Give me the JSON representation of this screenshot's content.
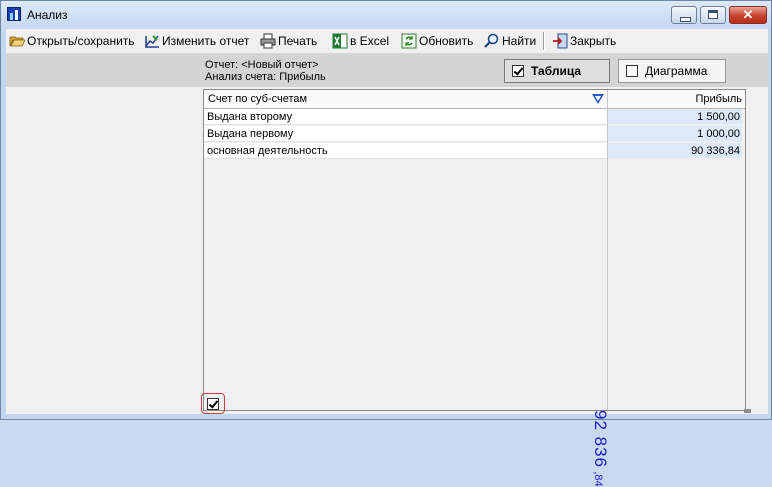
{
  "window": {
    "title": "Анализ"
  },
  "toolbar": {
    "open_save": "Открыть/сохранить",
    "edit_report": "Изменить отчет",
    "print": "Печать",
    "to_excel": "в Excel",
    "refresh": "Обновить",
    "find": "Найти",
    "close": "Закрыть"
  },
  "info": {
    "report_line": "Отчет:  <Новый отчет>",
    "analysis_line": "Анализ счета:  Прибыль"
  },
  "view": {
    "table_label": "Таблица",
    "table_checked": true,
    "chart_label": "Диаграмма",
    "chart_checked": false
  },
  "grid": {
    "columns": [
      "Счет по суб-счетам",
      "Прибыль"
    ],
    "rows": [
      {
        "name": "Выдана второму",
        "value": "1 500,00"
      },
      {
        "name": "Выдана первому",
        "value": "1 000,00"
      },
      {
        "name": "основная деятельность",
        "value": "90 336,84"
      }
    ],
    "total_int": "92 836",
    "total_frac": ",84"
  },
  "bottom_checkbox": {
    "checked": true
  },
  "colors": {
    "accent": "#1c1ccf",
    "value_bg": "#dde9f7",
    "filter": "#2b57c7"
  }
}
